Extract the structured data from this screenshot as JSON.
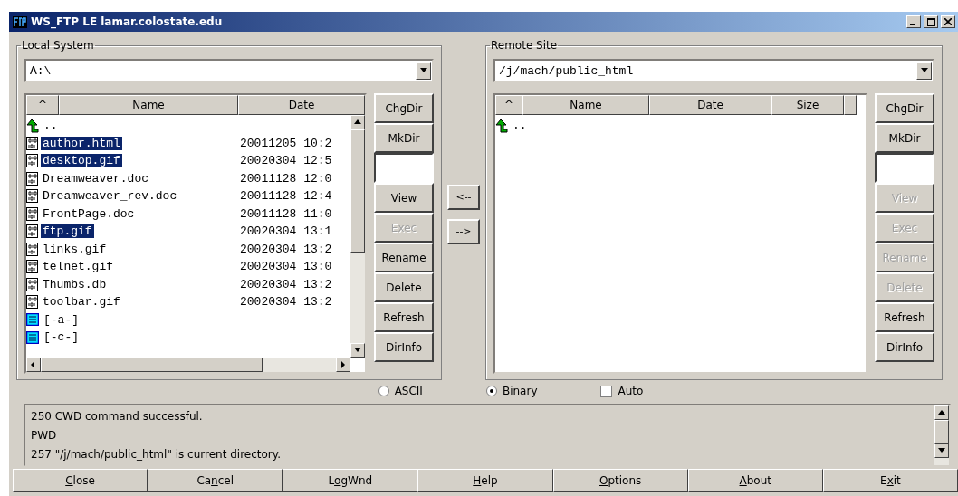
{
  "window": {
    "title": "WS_FTP LE lamar.colostate.edu"
  },
  "local": {
    "label": "Local System",
    "path": "A:\\",
    "columns": [
      "^",
      "Name",
      "Date"
    ],
    "files": [
      {
        "kind": "up",
        "name": "..",
        "selected": false
      },
      {
        "kind": "file",
        "name": "author.html",
        "date": "20011205 10:2",
        "selected": true
      },
      {
        "kind": "file",
        "name": "desktop.gif",
        "date": "20020304 12:5",
        "selected": true
      },
      {
        "kind": "file",
        "name": "Dreamweaver.doc",
        "date": "20011128 12:0",
        "selected": false
      },
      {
        "kind": "file",
        "name": "Dreamweaver_rev.doc",
        "date": "20011128 12:4",
        "selected": false
      },
      {
        "kind": "file",
        "name": "FrontPage.doc",
        "date": "20011128 11:0",
        "selected": false
      },
      {
        "kind": "file",
        "name": "ftp.gif",
        "date": "20020304 13:1",
        "selected": true
      },
      {
        "kind": "file",
        "name": "links.gif",
        "date": "20020304 13:2",
        "selected": false
      },
      {
        "kind": "file",
        "name": "telnet.gif",
        "date": "20020304 13:0",
        "selected": false
      },
      {
        "kind": "file",
        "name": "Thumbs.db",
        "date": "20020304 13:2",
        "selected": false
      },
      {
        "kind": "file",
        "name": "toolbar.gif",
        "date": "20020304 13:2",
        "selected": false
      },
      {
        "kind": "drive",
        "name": "[-a-]",
        "selected": false
      },
      {
        "kind": "drive",
        "name": "[-c-]",
        "selected": false
      }
    ],
    "buttons": [
      {
        "kind": "button",
        "label": "ChgDir",
        "disabled": false
      },
      {
        "kind": "button",
        "label": "MkDir",
        "disabled": false
      },
      {
        "kind": "input"
      },
      {
        "kind": "button",
        "label": "View",
        "disabled": false
      },
      {
        "kind": "button",
        "label": "Exec",
        "disabled": true
      },
      {
        "kind": "button",
        "label": "Rename",
        "disabled": false
      },
      {
        "kind": "button",
        "label": "Delete",
        "disabled": false
      },
      {
        "kind": "button",
        "label": "Refresh",
        "disabled": false
      },
      {
        "kind": "button",
        "label": "DirInfo",
        "disabled": false
      }
    ]
  },
  "transfer": [
    "<--",
    "-->"
  ],
  "remote": {
    "label": "Remote Site",
    "path": "/j/mach/public_html",
    "columns": [
      "^",
      "Name",
      "Date",
      "Size"
    ],
    "files": [
      {
        "kind": "up",
        "name": "..",
        "selected": false
      }
    ],
    "buttons": [
      {
        "kind": "button",
        "label": "ChgDir",
        "disabled": false
      },
      {
        "kind": "button",
        "label": "MkDir",
        "disabled": false
      },
      {
        "kind": "input"
      },
      {
        "kind": "button",
        "label": "View",
        "disabled": true
      },
      {
        "kind": "button",
        "label": "Exec",
        "disabled": true
      },
      {
        "kind": "button",
        "label": "Rename",
        "disabled": true
      },
      {
        "kind": "button",
        "label": "Delete",
        "disabled": true
      },
      {
        "kind": "button",
        "label": "Refresh",
        "disabled": false
      },
      {
        "kind": "button",
        "label": "DirInfo",
        "disabled": false
      }
    ]
  },
  "modes": [
    {
      "kind": "radio",
      "label": "ASCII",
      "selected": false
    },
    {
      "kind": "radio",
      "label": "Binary",
      "selected": true
    },
    {
      "kind": "checkbox",
      "label": "Auto",
      "checked": false
    }
  ],
  "log": [
    "250 CWD command successful.",
    "PWD",
    "257 \"/j/mach/public_html\" is current directory."
  ],
  "bottom_buttons": [
    {
      "label_parts": [
        {
          "text": "C",
          "underlined": true
        },
        {
          "text": "lose",
          "underlined": false
        }
      ]
    },
    {
      "label_parts": [
        {
          "text": "Ca",
          "underlined": false
        },
        {
          "text": "n",
          "underlined": true
        },
        {
          "text": "cel",
          "underlined": false
        }
      ]
    },
    {
      "label_parts": [
        {
          "text": "L",
          "underlined": false
        },
        {
          "text": "o",
          "underlined": true
        },
        {
          "text": "gWnd",
          "underlined": false
        }
      ]
    },
    {
      "label_parts": [
        {
          "text": "H",
          "underlined": true
        },
        {
          "text": "elp",
          "underlined": false
        }
      ]
    },
    {
      "label_parts": [
        {
          "text": "O",
          "underlined": true
        },
        {
          "text": "ptions",
          "underlined": false
        }
      ]
    },
    {
      "label_parts": [
        {
          "text": "A",
          "underlined": true
        },
        {
          "text": "bout",
          "underlined": false
        }
      ]
    },
    {
      "label_parts": [
        {
          "text": "E",
          "underlined": false
        },
        {
          "text": "x",
          "underlined": true
        },
        {
          "text": "it",
          "underlined": false
        }
      ]
    }
  ]
}
